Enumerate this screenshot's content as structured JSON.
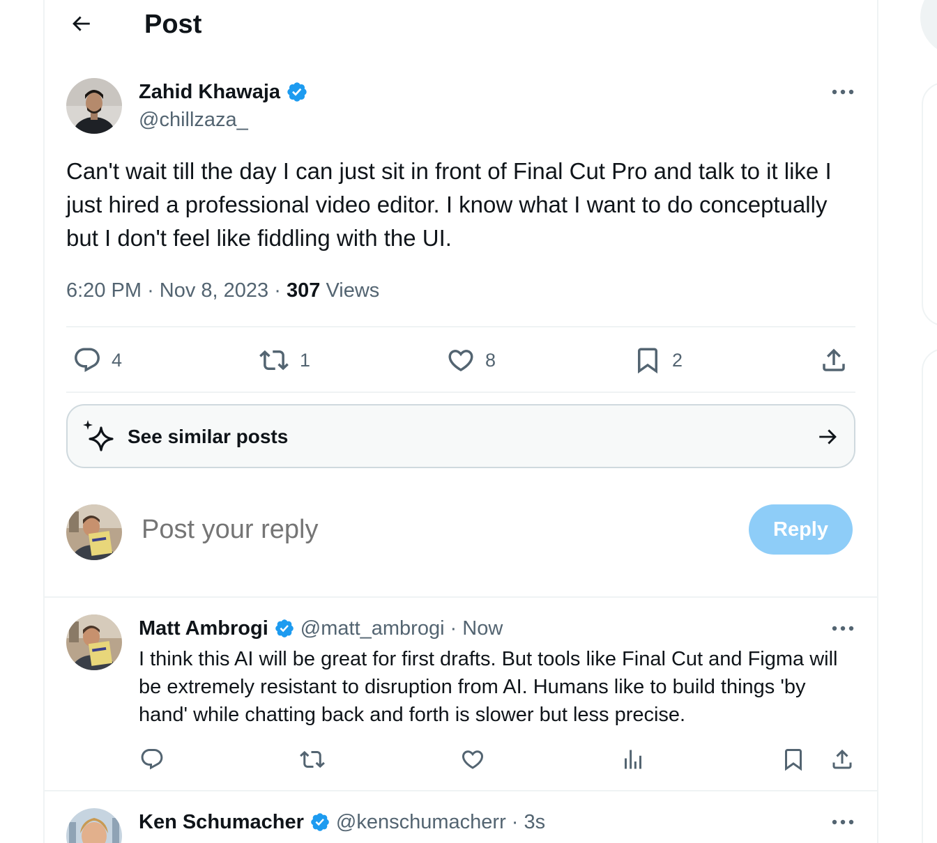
{
  "header": {
    "title": "Post",
    "back_icon": "arrow-left-icon"
  },
  "post": {
    "author_name": "Zahid Khawaja",
    "author_handle": "@chillzaza_",
    "verified": true,
    "text": "Can't wait till the day I can just sit in front of Final Cut Pro and talk to it like I just hired a professional video editor. I know what I want to do conceptually but I don't feel like fiddling with the UI.",
    "time": "6:20 PM",
    "date": "Nov 8, 2023",
    "views_count": "307",
    "views_label": "Views",
    "separator": "·",
    "stats": {
      "replies": "4",
      "reposts": "1",
      "likes": "8",
      "bookmarks": "2"
    }
  },
  "similar": {
    "label": "See similar posts"
  },
  "composer": {
    "placeholder": "Post your reply",
    "button": "Reply"
  },
  "replies": [
    {
      "name": "Matt Ambrogi",
      "handle": "@matt_ambrogi",
      "time": "· Now",
      "verified": true,
      "text": "I think this AI will be great for first drafts. But tools like Final Cut and Figma will be extremely resistant to disruption from AI. Humans like to build things 'by hand' while chatting back and forth is slower but less precise."
    },
    {
      "name": "Ken Schumacher",
      "handle": "@kenschumacherr",
      "time": "· 3s",
      "verified": true,
      "text": ""
    }
  ],
  "colors": {
    "text_primary": "#0f1419",
    "text_secondary": "#536471",
    "verified_blue": "#1d9bf0",
    "reply_button_disabled": "#8ecdf8",
    "border": "#eff3f4"
  }
}
